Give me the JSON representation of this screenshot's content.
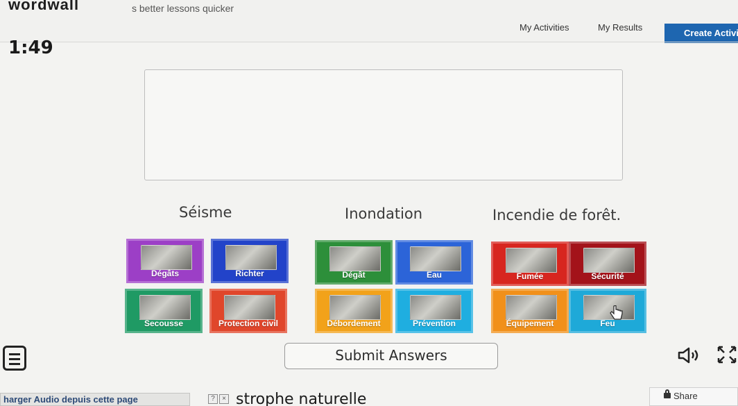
{
  "header": {
    "brand": "wordwall",
    "tagline": "s better lessons quicker",
    "nav": {
      "my_activities": "My Activities",
      "my_results": "My Results",
      "create_activity": "Create Activit"
    }
  },
  "timer": {
    "value": "1:49"
  },
  "question": {
    "text": ""
  },
  "groups": [
    {
      "label": "Séisme",
      "tiles": [
        {
          "label": "Dégâts",
          "color": "#9c3fc6"
        },
        {
          "label": "Richter",
          "color": "#2243c9"
        },
        {
          "label": "Secousse",
          "color": "#1f9a64"
        },
        {
          "label": "Protection civil",
          "color": "#e0462b"
        }
      ]
    },
    {
      "label": "Inondation",
      "tiles": [
        {
          "label": "Dégât",
          "color": "#2d8f3a"
        },
        {
          "label": "Eau",
          "color": "#2c64d8"
        },
        {
          "label": "Débordement",
          "color": "#f2a21a"
        },
        {
          "label": "Prévention",
          "color": "#1faee0"
        }
      ]
    },
    {
      "label": "Incendie de forêt.",
      "tiles": [
        {
          "label": "Fumée",
          "color": "#d7261f"
        },
        {
          "label": "Sécurité",
          "color": "#a3131a"
        },
        {
          "label": "Équipement",
          "color": "#f1901a"
        },
        {
          "label": "Feu",
          "color": "#1ea9d8"
        }
      ]
    }
  ],
  "controls": {
    "submit_label": "Submit Answers",
    "menu_icon": "hamburger-menu-icon",
    "sound_icon": "speaker-icon",
    "fullscreen_icon": "fullscreen-icon"
  },
  "footer": {
    "audio_link": "harger Audio depuis cette page",
    "help_glyph": "?",
    "close_glyph": "×",
    "activity_title": "strophe naturelle",
    "share_label": "Share"
  }
}
